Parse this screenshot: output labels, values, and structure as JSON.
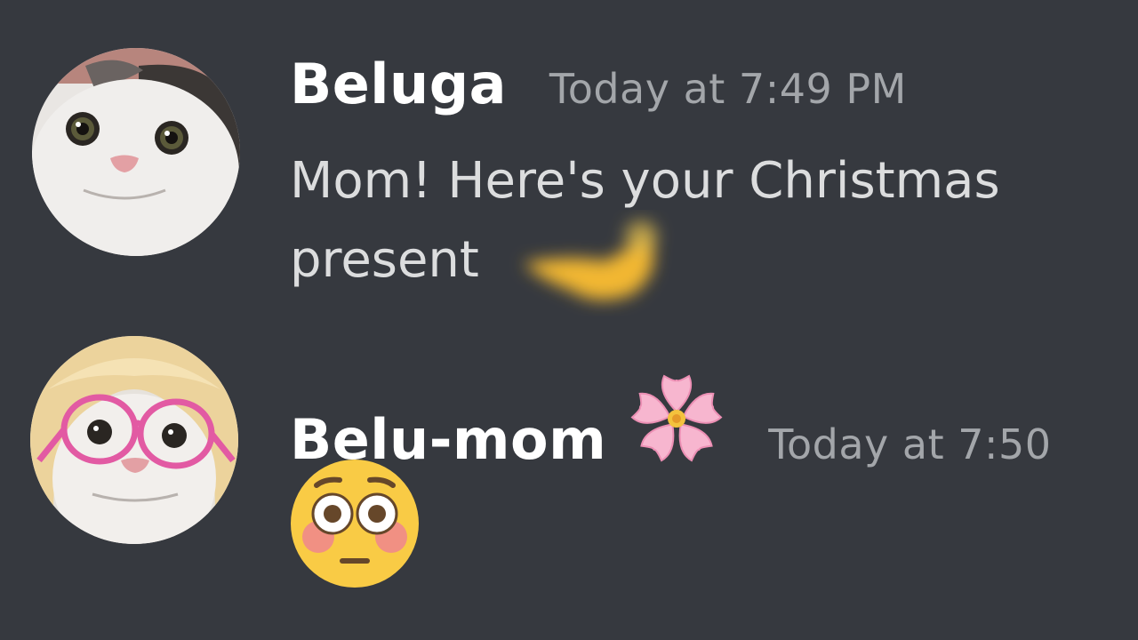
{
  "messages": [
    {
      "author": "Beluga",
      "timestamp": "Today at 7:49 PM",
      "content_line1": "Mom! Here's your Christmas",
      "content_line2": "present",
      "avatar_icon": "white-cat-avatar",
      "attachment_icon": "blurred-yellow-emoji"
    },
    {
      "author": "Belu-mom",
      "timestamp": "Today at 7:50",
      "author_badge_icon": "cherry-blossom-icon",
      "content_emoji": "flushed-face-emoji",
      "avatar_icon": "white-cat-with-blonde-wig-and-pink-glasses-avatar"
    }
  ],
  "colors": {
    "background": "#36393f",
    "username": "#ffffff",
    "timestamp": "#a3a6aa",
    "message_text": "#dcddde"
  }
}
